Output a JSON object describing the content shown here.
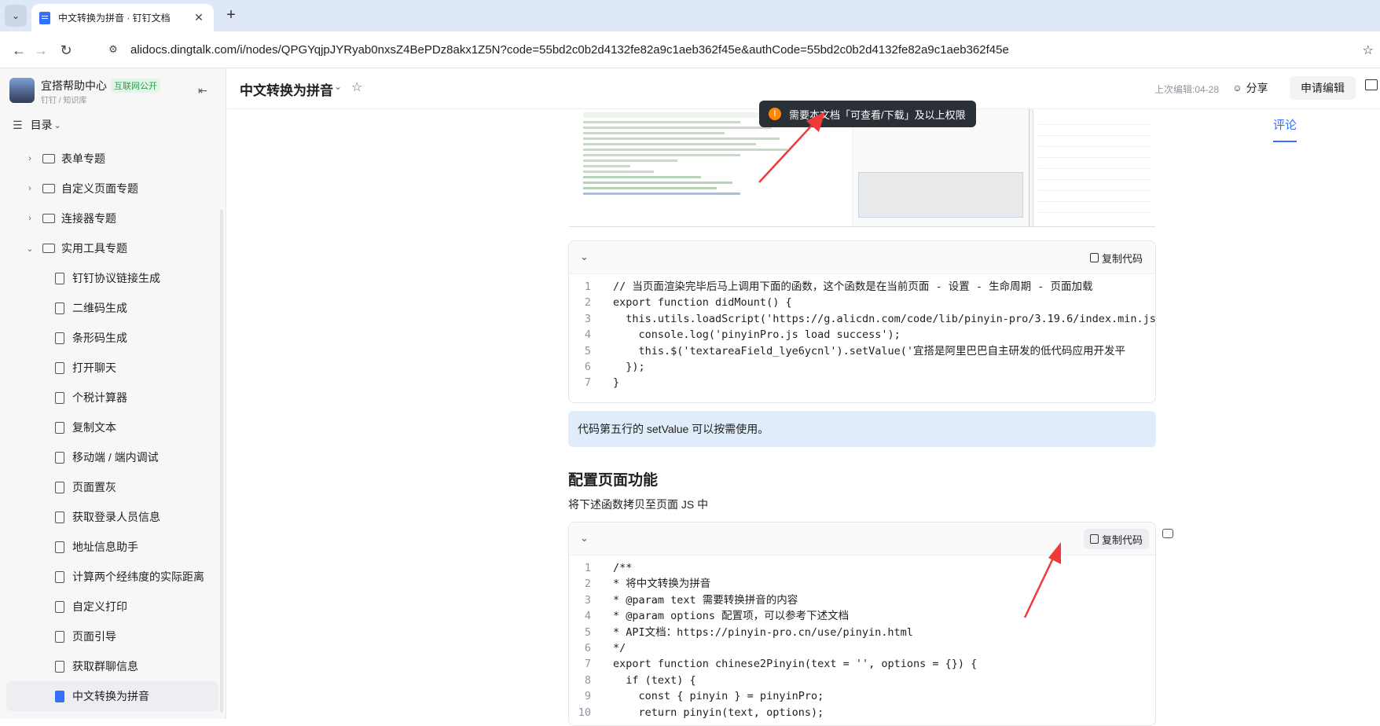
{
  "browser": {
    "tab_title": "中文转换为拼音 · 钉钉文档",
    "url": "alidocs.dingtalk.com/i/nodes/QPGYqjpJYRyab0nxsZ4BePDz8akx1Z5N?code=55bd2c0b2d4132fe82a9c1aeb362f45e&authCode=55bd2c0b2d4132fe82a9c1aeb362f45e"
  },
  "sidebar": {
    "brand_name": "宜搭帮助中心",
    "brand_badge": "互联网公开",
    "crumbs": "钉钉 / 知识库",
    "toc_label": "目录",
    "folders": [
      {
        "label": "表单专题"
      },
      {
        "label": "自定义页面专题"
      },
      {
        "label": "连接器专题"
      },
      {
        "label": "实用工具专题"
      }
    ],
    "docs": [
      {
        "label": "钉钉协议链接生成"
      },
      {
        "label": "二维码生成"
      },
      {
        "label": "条形码生成"
      },
      {
        "label": "打开聊天"
      },
      {
        "label": "个税计算器"
      },
      {
        "label": "复制文本"
      },
      {
        "label": "移动端 / 端内调试"
      },
      {
        "label": "页面置灰"
      },
      {
        "label": "获取登录人员信息"
      },
      {
        "label": "地址信息助手"
      },
      {
        "label": "计算两个经纬度的实际距离"
      },
      {
        "label": "自定义打印"
      },
      {
        "label": "页面引导"
      },
      {
        "label": "获取群聊信息"
      },
      {
        "label": "中文转换为拼音"
      }
    ]
  },
  "header": {
    "title": "中文转换为拼音",
    "last_edit": "上次编辑:04-28",
    "share_label": "分享",
    "edit_label": "申请编辑"
  },
  "toast": {
    "text": "需要本文档「可查看/下载」及以上权限"
  },
  "comment_tab": "评论",
  "code1": {
    "copy_label": "复制代码",
    "lines": [
      {
        "n": "1",
        "t": "// 当页面渲染完毕后马上调用下面的函数，这个函数是在当前页面 - 设置 - 生命周期 - 页面加载"
      },
      {
        "n": "2",
        "t": "export function didMount() {"
      },
      {
        "n": "3",
        "t": "  this.utils.loadScript('https://g.alicdn.com/code/lib/pinyin-pro/3.19.6/index.min.js')"
      },
      {
        "n": "4",
        "t": "    console.log('pinyinPro.js load success');"
      },
      {
        "n": "5",
        "t": "    this.$('textareaField_lye6ycnl').setValue('宜搭是阿里巴巴自主研发的低代码应用开发平"
      },
      {
        "n": "6",
        "t": "  });"
      },
      {
        "n": "7",
        "t": "}"
      }
    ]
  },
  "callout": "代码第五行的 setValue 可以按需使用。",
  "section_title": "配置页面功能",
  "section_para": "将下述函数拷贝至页面 JS 中",
  "code2": {
    "copy_label": "复制代码",
    "lines": [
      {
        "n": "1",
        "t": "/**"
      },
      {
        "n": "2",
        "t": "* 将中文转换为拼音"
      },
      {
        "n": "3",
        "t": "* @param text 需要转换拼音的内容"
      },
      {
        "n": "4",
        "t": "* @param options 配置项，可以参考下述文档"
      },
      {
        "n": "5",
        "t": "* API文档：https://pinyin-pro.cn/use/pinyin.html"
      },
      {
        "n": "6",
        "t": "*/"
      },
      {
        "n": "7",
        "t": "export function chinese2Pinyin(text = '', options = {}) {"
      },
      {
        "n": "8",
        "t": "  if (text) {"
      },
      {
        "n": "9",
        "t": "    const { pinyin } = pinyinPro;"
      },
      {
        "n": "10",
        "t": "    return pinyin(text, options);"
      }
    ]
  }
}
